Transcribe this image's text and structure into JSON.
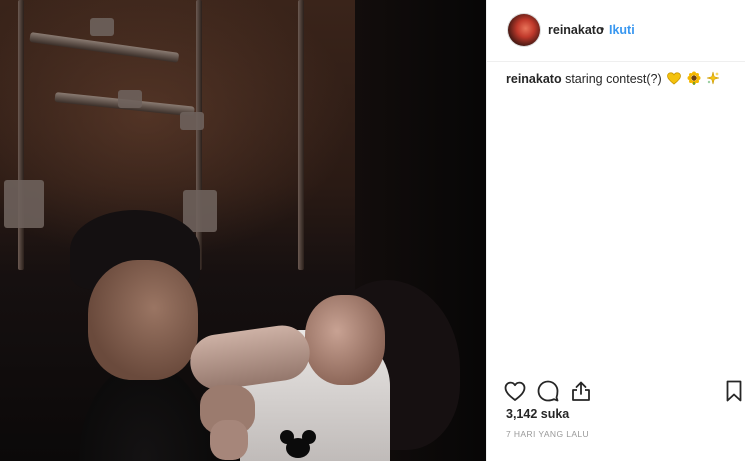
{
  "post": {
    "username": "reinakato",
    "separator": "•",
    "follow_label": "Ikuti",
    "caption_text": "staring contest(?)",
    "caption_emojis": [
      "yellow-heart-icon",
      "sunflower-icon",
      "sparkle-icon"
    ],
    "likes_text": "3,142 suka",
    "time_text": "7 HARI YANG LALU"
  },
  "icons": {
    "like": "heart-icon",
    "comment": "comment-icon",
    "share": "share-icon",
    "save": "bookmark-icon"
  },
  "colors": {
    "link": "#3897f0",
    "text": "#262626",
    "muted": "#999999",
    "divider": "#efefef"
  }
}
